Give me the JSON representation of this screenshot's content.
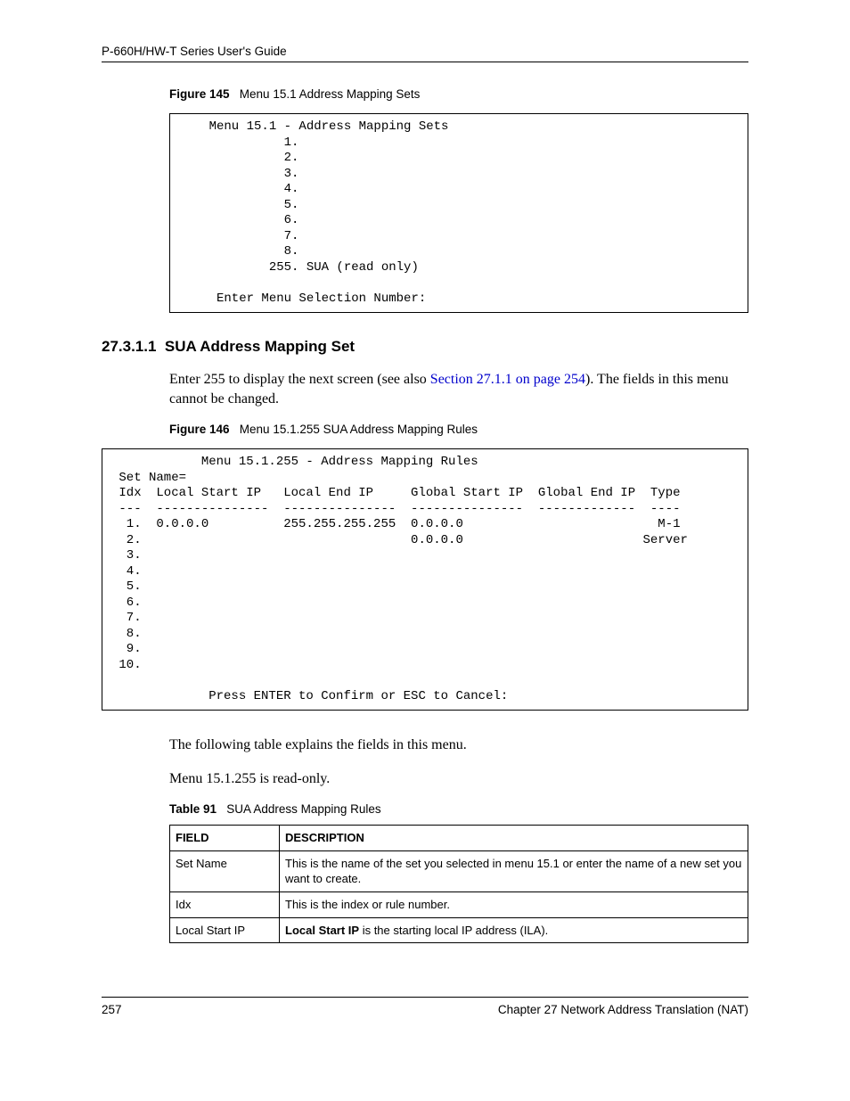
{
  "header": {
    "guide_title": "P-660H/HW-T Series User's Guide"
  },
  "figure145": {
    "label": "Figure 145",
    "title": "Menu 15.1 Address Mapping Sets",
    "content": "    Menu 15.1 - Address Mapping Sets\n              1.\n              2.\n              3.\n              4.\n              5.\n              6.\n              7.\n              8.\n            255. SUA (read only)\n\n     Enter Menu Selection Number:"
  },
  "section": {
    "number": "27.3.1.1",
    "title": "SUA Address Mapping Set",
    "para1_pre": "Enter 255 to display the next screen (see also ",
    "para1_link": "Section 27.1.1 on page 254",
    "para1_post": "). The fields in this menu cannot be changed."
  },
  "figure146": {
    "label": "Figure 146",
    "title": "Menu 15.1.255 SUA Address Mapping Rules",
    "content": "            Menu 15.1.255 - Address Mapping Rules\n Set Name=\n Idx  Local Start IP   Local End IP     Global Start IP  Global End IP  Type\n ---  ---------------  ---------------  ---------------  -------------  ----\n  1.  0.0.0.0          255.255.255.255  0.0.0.0                          M-1\n  2.                                    0.0.0.0                        Server\n  3.\n  4.\n  5.\n  6.\n  7.\n  8.\n  9.\n 10.\n\n             Press ENTER to Confirm or ESC to Cancel:"
  },
  "chart_data": {
    "type": "table",
    "title": "Menu 15.1.255 - Address Mapping Rules",
    "columns": [
      "Idx",
      "Local Start IP",
      "Local End IP",
      "Global Start IP",
      "Global End IP",
      "Type"
    ],
    "rows": [
      {
        "Idx": 1,
        "Local Start IP": "0.0.0.0",
        "Local End IP": "255.255.255.255",
        "Global Start IP": "0.0.0.0",
        "Global End IP": "",
        "Type": "M-1"
      },
      {
        "Idx": 2,
        "Local Start IP": "",
        "Local End IP": "",
        "Global Start IP": "0.0.0.0",
        "Global End IP": "",
        "Type": "Server"
      },
      {
        "Idx": 3
      },
      {
        "Idx": 4
      },
      {
        "Idx": 5
      },
      {
        "Idx": 6
      },
      {
        "Idx": 7
      },
      {
        "Idx": 8
      },
      {
        "Idx": 9
      },
      {
        "Idx": 10
      }
    ]
  },
  "after_fig146": {
    "para2": "The following table explains the fields in this menu.",
    "para3": "Menu 15.1.255 is read-only."
  },
  "table91": {
    "label": "Table 91",
    "title": "SUA Address Mapping Rules",
    "headers": {
      "field": "FIELD",
      "desc": "DESCRIPTION"
    },
    "rows": [
      {
        "field": "Set Name",
        "desc": "This is the name of the set you selected in menu 15.1 or enter the name of a new set you want to create."
      },
      {
        "field": "Idx",
        "desc": "This is the index or rule number."
      },
      {
        "field": "Local Start IP",
        "desc_bold": "Local Start IP",
        "desc_rest": " is the starting local IP address (ILA)."
      }
    ]
  },
  "footer": {
    "page": "257",
    "chapter": "Chapter 27 Network Address Translation (NAT)"
  }
}
